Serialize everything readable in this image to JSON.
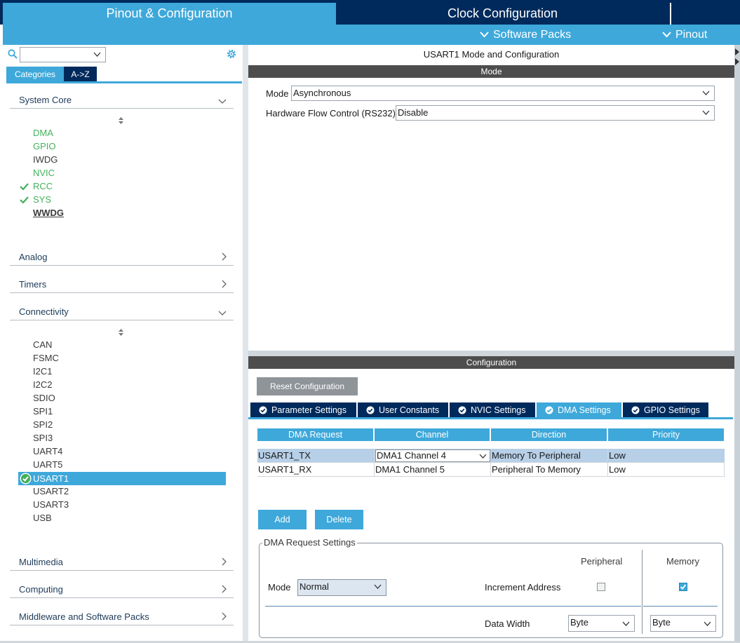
{
  "header": {
    "tabs": [
      {
        "label": "Pinout & Configuration",
        "active": true
      },
      {
        "label": "Clock Configuration",
        "active": false
      }
    ],
    "menu": [
      {
        "label": "Software Packs"
      },
      {
        "label": "Pinout"
      }
    ]
  },
  "sidebar": {
    "search": {
      "value": ""
    },
    "tabs": {
      "categories": "Categories",
      "az": "A->Z"
    },
    "categories": [
      {
        "label": "System Core",
        "expanded": true
      },
      {
        "label": "Analog",
        "expanded": false
      },
      {
        "label": "Timers",
        "expanded": false
      },
      {
        "label": "Connectivity",
        "expanded": true
      },
      {
        "label": "Multimedia",
        "expanded": false
      },
      {
        "label": "Computing",
        "expanded": false
      },
      {
        "label": "Middleware and Software Packs",
        "expanded": false
      }
    ],
    "system_core_items": [
      {
        "label": "DMA",
        "state": "configured"
      },
      {
        "label": "GPIO",
        "state": "configured"
      },
      {
        "label": "IWDG",
        "state": "none"
      },
      {
        "label": "NVIC",
        "state": "configured"
      },
      {
        "label": "RCC",
        "state": "checked"
      },
      {
        "label": "SYS",
        "state": "checked"
      },
      {
        "label": "WWDG",
        "state": "bold"
      }
    ],
    "connectivity_items": [
      {
        "label": "CAN"
      },
      {
        "label": "FSMC"
      },
      {
        "label": "I2C1"
      },
      {
        "label": "I2C2"
      },
      {
        "label": "SDIO"
      },
      {
        "label": "SPI1"
      },
      {
        "label": "SPI2"
      },
      {
        "label": "SPI3"
      },
      {
        "label": "UART4"
      },
      {
        "label": "UART5"
      },
      {
        "label": "USART1",
        "selected": true,
        "checked": true
      },
      {
        "label": "USART2"
      },
      {
        "label": "USART3"
      },
      {
        "label": "USB"
      }
    ]
  },
  "mode_panel": {
    "title": "USART1 Mode and Configuration",
    "section_label": "Mode",
    "mode_label": "Mode",
    "mode_value": "Asynchronous",
    "flow_label": "Hardware Flow Control (RS232)",
    "flow_value": "Disable"
  },
  "config_panel": {
    "section_label": "Configuration",
    "reset_button": "Reset Configuration",
    "tabs": [
      {
        "label": "Parameter Settings",
        "active": false
      },
      {
        "label": "User Constants",
        "active": false
      },
      {
        "label": "NVIC Settings",
        "active": false
      },
      {
        "label": "DMA Settings",
        "active": true
      },
      {
        "label": "GPIO Settings",
        "active": false
      }
    ],
    "dma_table": {
      "headers": [
        "DMA Request",
        "Channel",
        "Direction",
        "Priority"
      ],
      "rows": [
        {
          "request": "USART1_TX",
          "channel": "DMA1 Channel 4",
          "direction": "Memory To Peripheral",
          "priority": "Low",
          "selected": true
        },
        {
          "request": "USART1_RX",
          "channel": "DMA1 Channel 5",
          "direction": "Peripheral To Memory",
          "priority": "Low",
          "selected": false
        }
      ]
    },
    "add_button": "Add",
    "delete_button": "Delete",
    "request_settings": {
      "legend": "DMA Request Settings",
      "col_peripheral": "Peripheral",
      "col_memory": "Memory",
      "mode_label": "Mode",
      "mode_value": "Normal",
      "increment_label": "Increment Address",
      "increment_peripheral": false,
      "increment_memory": true,
      "data_width_label": "Data Width",
      "data_width_peripheral": "Byte",
      "data_width_memory": "Byte"
    }
  },
  "colors": {
    "accent": "#3ea8da",
    "navy": "#002a5c",
    "configured_green": "#44b05c",
    "bar_gray": "#4d4d4d"
  }
}
